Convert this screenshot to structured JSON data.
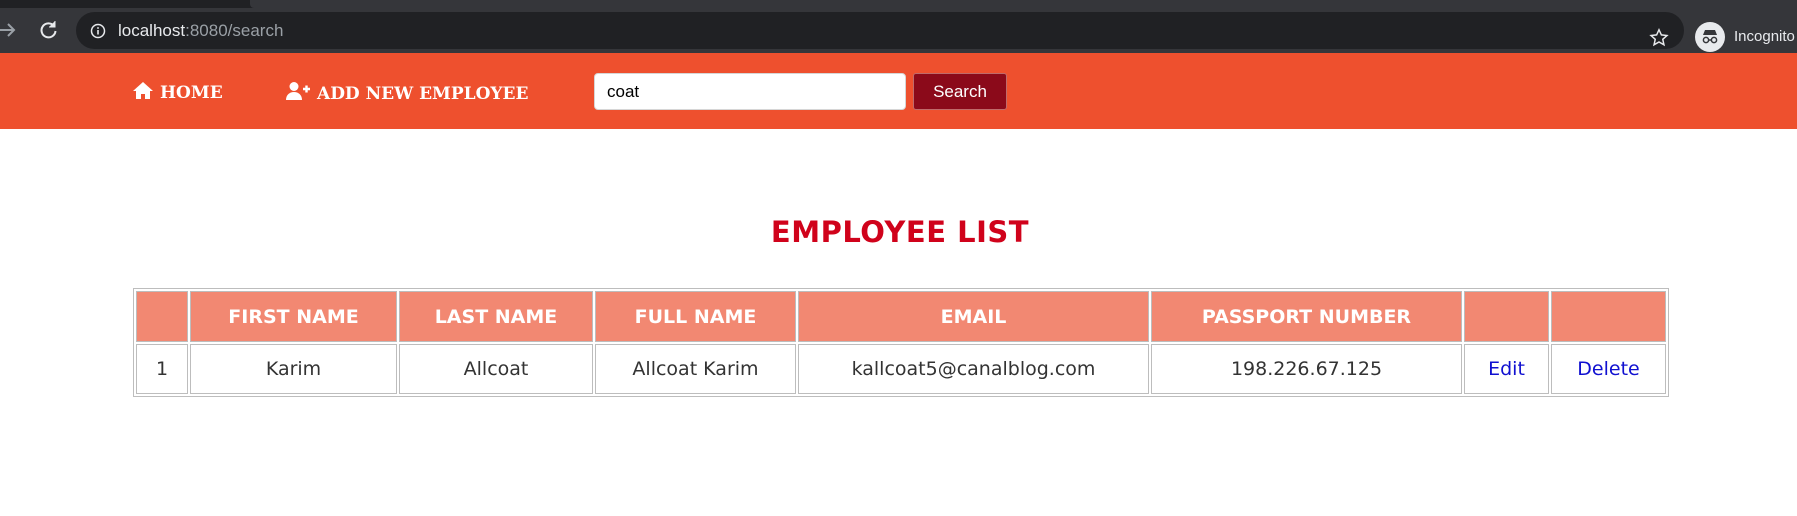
{
  "browser": {
    "url_host": "localhost",
    "url_path": ":8080/search",
    "profile_label": "Incognito"
  },
  "navbar": {
    "home_label": "HOME",
    "add_label": "ADD NEW EMPLOYEE",
    "search_value": "coat",
    "search_button_label": "Search",
    "background_color": "#ee502e",
    "button_color": "#8b0a1a"
  },
  "page": {
    "title": "EMPLOYEE LIST",
    "title_color": "#d0021b"
  },
  "table": {
    "headers": [
      "",
      "FIRST NAME",
      "LAST NAME",
      "FULL NAME",
      "EMAIL",
      "PASSPORT NUMBER",
      "",
      ""
    ],
    "rows": [
      {
        "index": "1",
        "first_name": "Karim",
        "last_name": "Allcoat",
        "full_name": "Allcoat Karim",
        "email": "kallcoat5@canalblog.com",
        "passport": "198.226.67.125",
        "edit_label": "Edit",
        "delete_label": "Delete"
      }
    ],
    "header_color": "#f28872"
  }
}
